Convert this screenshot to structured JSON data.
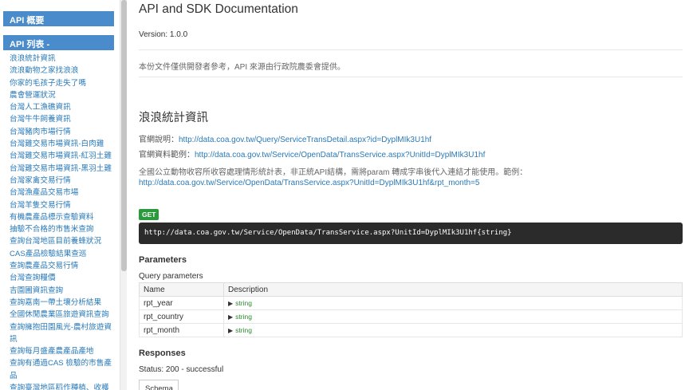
{
  "sidebar": {
    "overview_label": "API 概要",
    "list_label": "API 列表 -",
    "items": [
      "浪浪統計資訊",
      "流浪動物之家找浪浪",
      "你家的毛孩子走失了嗎",
      "農會營運狀況",
      "台灣人工漁礁資訊",
      "台灣牛牛飼養資訊",
      "台灣豬肉市場行情",
      "台灣雞交易市場資訊-白肉雞",
      "台灣雞交易市場資訊-紅羽土雞",
      "台灣雞交易市場資訊-黑羽土雞",
      "台灣家禽交易行情",
      "台灣漁產品交易市場",
      "台灣羊隻交易行情",
      "有機農產品標示查驗資料",
      "抽驗不合格的市售米查詢",
      "查詢台灣地區目前養蜂狀況",
      "CAS產品檢驗結果查巡",
      "查詢農產品交易行情",
      "台灣查詢糧價",
      "吉園圃資訊查詢",
      "查詢嘉南一帶土壤分析結果",
      "全國休閒農業區旅遊資訊查詢",
      "查詢擁抱田園風光-農村旅遊資訊",
      "查詢每月盛產農產品產地",
      "查詢有通過CAS 檢驗的市售產品",
      "查詢臺灣地區稻作種植、收穫面積及產量"
    ]
  },
  "main": {
    "title": "API and SDK Documentation",
    "version": "Version: 1.0.0",
    "description": "本份文件僅供開發者參考，API 來源由行政院農委會提供。",
    "section_title": "浪浪統計資訊",
    "official_desc_label": "官網說明：",
    "official_desc_url": "http://data.coa.gov.tw/Query/ServiceTransDetail.aspx?id=DyplMIk3U1hf",
    "official_example_label": "官網資料範例：",
    "official_example_url": "http://data.coa.gov.tw/Service/OpenData/TransService.aspx?UnitId=DyplMIk3U1hf",
    "note_text": "全國公立動物收容所收容處理情形統計表，非正統API結構，需將param 轉成字串後代入連結才能使用。範例：",
    "note_url": "http://data.coa.gov.tw/Service/OpenData/TransService.aspx?UnitId=DyplMIk3U1hf&rpt_month=5",
    "method": "GET",
    "endpoint": "http://data.coa.gov.tw/Service/OpenData/TransService.aspx?UnitId=DyplMIk3U1hf{string}",
    "parameters_heading": "Parameters",
    "query_params_label": "Query parameters",
    "table_headers": [
      "Name",
      "Description"
    ],
    "params": [
      {
        "name": "rpt_year",
        "type": "string"
      },
      {
        "name": "rpt_country",
        "type": "string"
      },
      {
        "name": "rpt_month",
        "type": "string"
      }
    ],
    "responses_heading": "Responses",
    "status_text": "Status: 200 - successful",
    "schema_tab": "Schema"
  },
  "colors": {
    "nav_header_bg": "#4a8ccb",
    "link": "#2a7ab8",
    "get_badge": "#2a9a3c",
    "url_bar_bg": "#2b2b2b",
    "type_green": "#2a8a2a"
  }
}
